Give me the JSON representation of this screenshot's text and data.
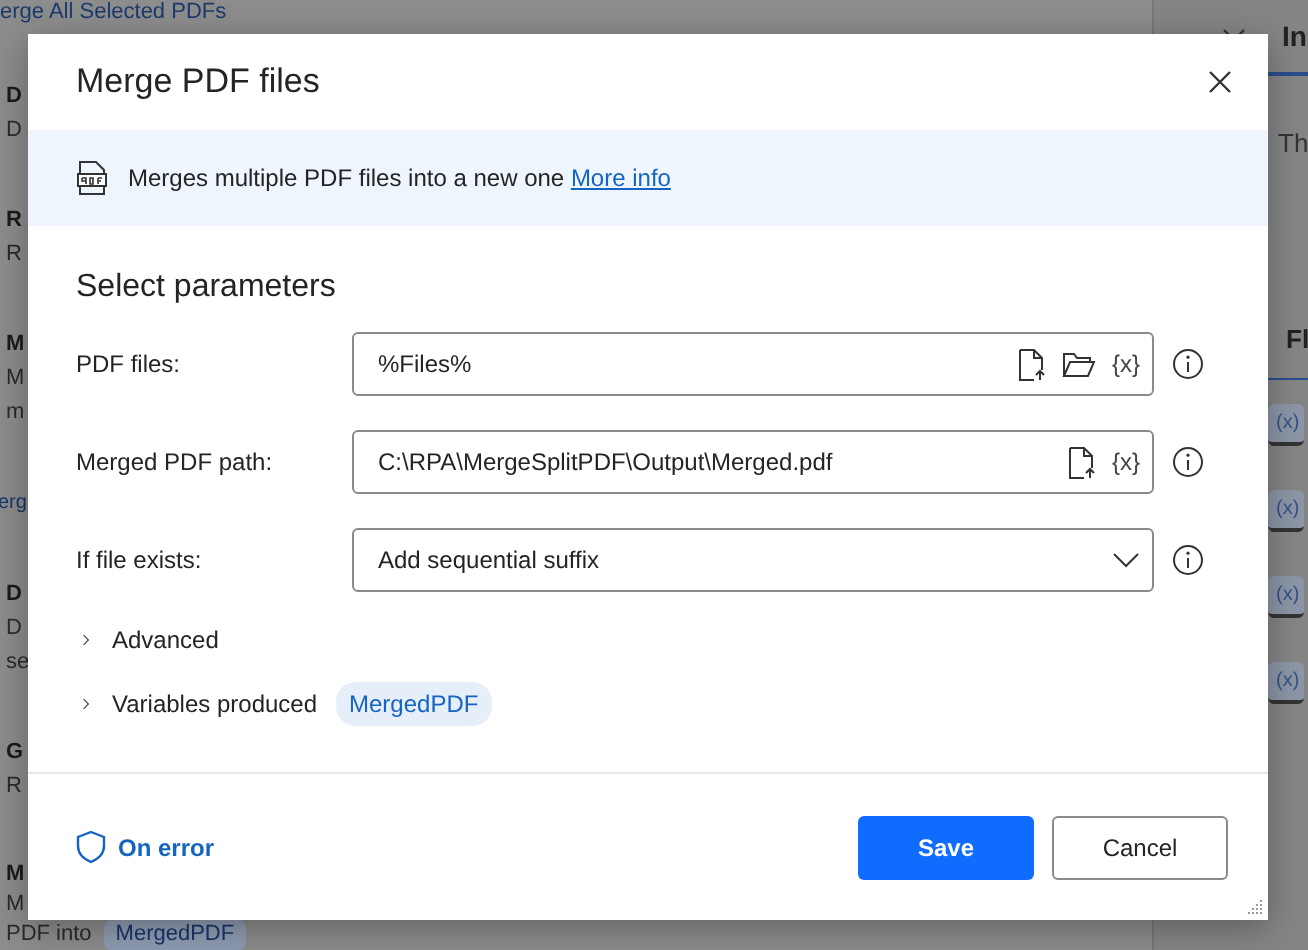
{
  "background": {
    "top_link": "erge All Selected PDFs",
    "left_items": [
      {
        "kind": "action",
        "lines": [
          "D",
          "D"
        ]
      },
      {
        "kind": "action",
        "lines": [
          "R",
          "R"
        ]
      },
      {
        "kind": "action",
        "lines": [
          "M",
          "M",
          "m"
        ]
      },
      {
        "kind": "link",
        "lines": [
          "erg"
        ]
      },
      {
        "kind": "action",
        "lines": [
          "D",
          "D",
          "se"
        ]
      },
      {
        "kind": "action",
        "lines": [
          "G",
          "R"
        ]
      },
      {
        "kind": "action",
        "lines": [
          "M",
          "M",
          "PDF into"
        ],
        "variable": "MergedPDF"
      }
    ],
    "right_panel": {
      "header": "In",
      "text": "Th",
      "section": "Fl",
      "chips": [
        "(x)",
        "(x)",
        "(x)",
        "(x)"
      ]
    }
  },
  "dialog": {
    "title": "Merge PDF files",
    "description": "Merges multiple PDF files into a new one",
    "more_info": "More info",
    "section_title": "Select parameters",
    "parameters": [
      {
        "kind": "text",
        "label": "PDF files:",
        "value": "%Files%",
        "file_button": true,
        "folder_button": true,
        "variable_button": "{x}"
      },
      {
        "kind": "text",
        "label": "Merged PDF path:",
        "value": "C:\\RPA\\MergeSplitPDF\\Output\\Merged.pdf",
        "file_button": true,
        "folder_button": false,
        "variable_button": "{x}"
      },
      {
        "kind": "dropdown",
        "label": "If file exists:",
        "value": "Add sequential suffix"
      }
    ],
    "advanced": {
      "label": "Advanced",
      "expanded": false
    },
    "variables": {
      "label": "Variables produced",
      "expanded": false,
      "chips": [
        "MergedPDF"
      ]
    },
    "on_error": "On error",
    "buttons": [
      {
        "kind": "primary",
        "label": "Save"
      },
      {
        "kind": "secondary",
        "label": "Cancel"
      }
    ]
  }
}
